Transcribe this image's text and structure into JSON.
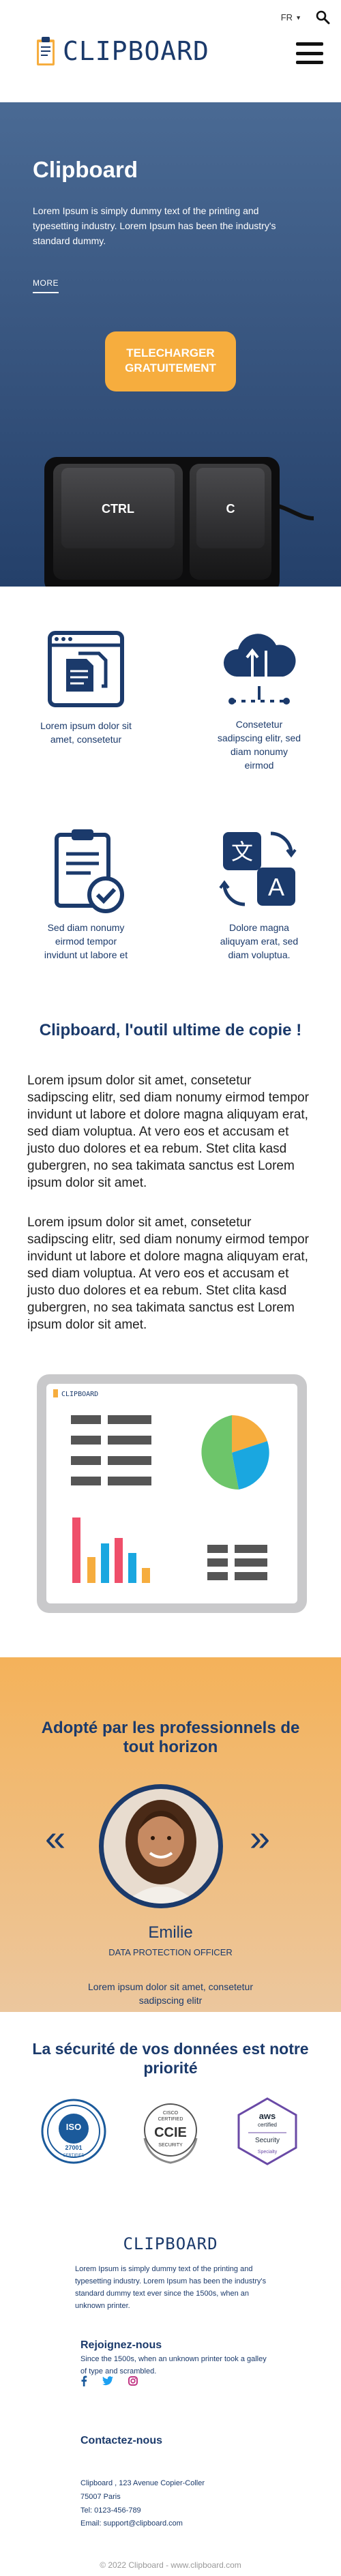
{
  "header": {
    "language": "FR",
    "logo_text": "CLIPBOARD"
  },
  "hero": {
    "title": "Clipboard",
    "text": "Lorem Ipsum is simply dummy text of the printing and typesetting industry. Lorem Ipsum has been the industry's standard dummy.",
    "more_label": "MORE",
    "cta_label": "TELECHARGER GRATUITEMENT",
    "keys": [
      "CTRL",
      "C"
    ]
  },
  "features": [
    {
      "icon": "documents-window-icon",
      "text": "Lorem ipsum dolor sit amet, consetetur"
    },
    {
      "icon": "cloud-sync-icon",
      "text": "Consetetur sadipscing elitr, sed diam nonumy eirmod"
    },
    {
      "icon": "clipboard-check-icon",
      "text": "Sed diam nonumy eirmod tempor invidunt ut labore et"
    },
    {
      "icon": "translate-icon",
      "text": "Dolore magna aliquyam erat, sed diam voluptua."
    }
  ],
  "intro": {
    "title": "Clipboard, l'outil ultime de copie !",
    "paragraphs": [
      "Lorem ipsum dolor sit amet, consetetur sadipscing elitr, sed diam nonumy eirmod tempor invidunt ut labore et dolore magna aliquyam erat, sed diam voluptua. At vero eos et accusam et justo duo dolores et ea rebum. Stet clita kasd gubergren, no sea takimata sanctus est Lorem ipsum dolor sit amet.",
      "Lorem ipsum dolor sit amet, consetetur sadipscing elitr, sed diam nonumy eirmod tempor invidunt ut labore et dolore magna aliquyam erat, sed diam voluptua. At vero eos et accusam et justo duo dolores et ea rebum. Stet clita kasd gubergren, no sea takimata sanctus est Lorem ipsum dolor sit amet."
    ]
  },
  "dashboard": {
    "brand": "CLIPBOARD"
  },
  "testimonials": {
    "title": "Adopté par les professionnels de tout horizon",
    "prev": "«",
    "next": "»",
    "name": "Emilie",
    "role": "DATA PROTECTION OFFICER",
    "quote": "Lorem ipsum dolor sit amet, consetetur sadipscing elitr"
  },
  "security": {
    "title": "La sécurité de vos données est notre priorité",
    "badges": [
      {
        "icon": "iso-badge-icon",
        "lines": [
          "ISO",
          "27001",
          "CERTIFIED"
        ]
      },
      {
        "icon": "ccie-badge-icon",
        "lines": [
          "CISCO",
          "CERTIFIED",
          "CCIE",
          "SECURITY"
        ]
      },
      {
        "icon": "aws-badge-icon",
        "lines": [
          "aws",
          "certified",
          "Security",
          "Specialty"
        ]
      }
    ]
  },
  "footer": {
    "logo": "CLIPBOARD",
    "description": "Lorem Ipsum is simply dummy text of the printing and typesetting industry. Lorem Ipsum has been the industry's standard dummy text ever since the 1500s, when an unknown printer.",
    "join_title": "Rejoignez-nous",
    "join_text": "Since the 1500s, when an unknown printer took a galley of type and scrambled.",
    "contact_title": "Contactez-nous",
    "address1": "Clipboard , 123 Avenue Copier-Coller",
    "address2": "75007 Paris",
    "phone": "Tel: 0123-456-789",
    "email": "Email: support@clipboard.com",
    "copyright": "© 2022 Clipboard - www.clipboard.com"
  },
  "colors": {
    "navy": "#1b3a6b",
    "accent": "#f6ad3e",
    "hero_top": "#4a6a94",
    "hero_bottom": "#24406a"
  }
}
